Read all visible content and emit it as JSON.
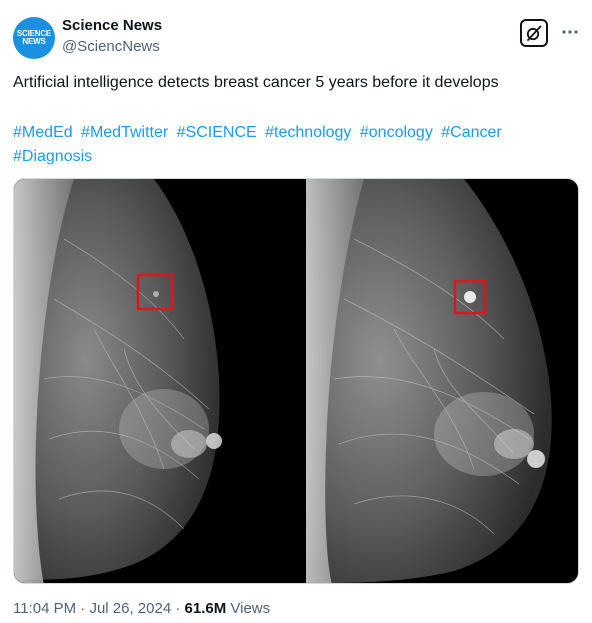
{
  "account": {
    "avatar_line1": "SCIENCE",
    "avatar_line2": "NEWS",
    "display_name": "Science News",
    "handle": "@SciencNews"
  },
  "tweet": {
    "text": "Artificial intelligence detects breast cancer 5 years before it develops",
    "hashtags": [
      "#MedEd",
      "#MedTwitter",
      "#SCIENCE",
      "#technology",
      "#oncology",
      "#Cancer",
      "#Diagnosis"
    ]
  },
  "media": {
    "description_icon": "mammogram-image"
  },
  "meta": {
    "time": "11:04 PM",
    "separator": "·",
    "date": "Jul 26, 2024",
    "views_count": "61.6M",
    "views_label": "Views"
  },
  "icons": {
    "grok": "grok-icon",
    "more": "more-icon"
  },
  "colors": {
    "link": "#1d9bf0",
    "avatar": "#1b8fe0",
    "highlight_box": "#e0141e"
  }
}
